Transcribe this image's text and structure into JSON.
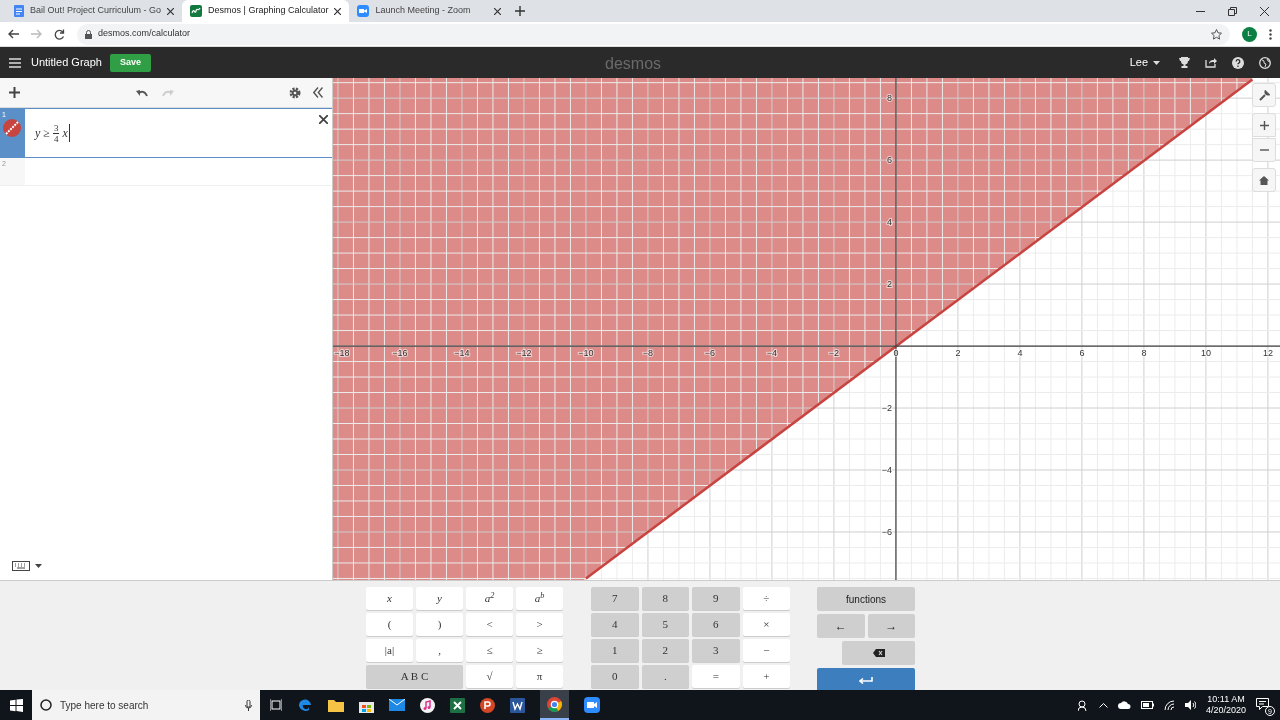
{
  "browser": {
    "tabs": [
      {
        "title": "Bail Out! Project Curriculum - Go",
        "selected": false
      },
      {
        "title": "Desmos | Graphing Calculator",
        "selected": true
      },
      {
        "title": "Launch Meeting - Zoom",
        "selected": false
      }
    ],
    "url": "desmos.com/calculator",
    "profile_initial": "L"
  },
  "header": {
    "graph_title": "Untitled Graph",
    "save_label": "Save",
    "logo": "desmos",
    "user": "Lee"
  },
  "expressions": [
    {
      "number": "1",
      "kind": "inequality",
      "selected": true,
      "color": "#c74440",
      "lhs": "y ≥",
      "numerator": "3",
      "denominator": "4",
      "rhs": "x"
    },
    {
      "number": "2",
      "kind": "empty",
      "selected": false
    }
  ],
  "graph": {
    "chart_data": {
      "type": "line",
      "x": [
        -10,
        11.5
      ],
      "series": [
        {
          "color": "#c74440",
          "values": [
            -7.5,
            8.6
          ]
        }
      ],
      "grid": true,
      "xlim": [
        -18.16,
        12.39
      ],
      "ylim": [
        -7.55,
        8.65
      ],
      "xticks": [
        -18,
        -16,
        -14,
        -12,
        -10,
        -8,
        -6,
        -4,
        -2,
        0,
        2,
        4,
        6,
        8,
        10,
        12
      ],
      "yticks": [
        -6,
        -4,
        -2,
        2,
        4,
        6,
        8
      ]
    }
  },
  "keypad": {
    "left": [
      {
        "label": "x",
        "kind": "light"
      },
      {
        "label": "y",
        "kind": "light"
      },
      {
        "label": "a$^{2}$",
        "kind": "light"
      },
      {
        "label": "a$^{b}$",
        "kind": "light"
      },
      {
        "label": "(",
        "kind": "light"
      },
      {
        "label": ")",
        "kind": "light"
      },
      {
        "label": "<",
        "kind": "light"
      },
      {
        "label": ">",
        "kind": "light"
      },
      {
        "label": "|a|",
        "kind": "light"
      },
      {
        "label": ",",
        "kind": "light"
      },
      {
        "label": "≤",
        "kind": "light"
      },
      {
        "label": "≥",
        "kind": "light"
      },
      {
        "label": "A B C",
        "kind": "wide"
      },
      {
        "label": "√",
        "kind": "light"
      },
      {
        "label": "π",
        "kind": "light"
      }
    ],
    "middle": [
      {
        "label": "7",
        "kind": "dark"
      },
      {
        "label": "8",
        "kind": "dark"
      },
      {
        "label": "9",
        "kind": "dark"
      },
      {
        "label": "÷",
        "kind": "light"
      },
      {
        "label": "4",
        "kind": "dark"
      },
      {
        "label": "5",
        "kind": "dark"
      },
      {
        "label": "6",
        "kind": "dark"
      },
      {
        "label": "×",
        "kind": "light"
      },
      {
        "label": "1",
        "kind": "dark"
      },
      {
        "label": "2",
        "kind": "dark"
      },
      {
        "label": "3",
        "kind": "dark"
      },
      {
        "label": "−",
        "kind": "light"
      },
      {
        "label": "0",
        "kind": "dark"
      },
      {
        "label": ".",
        "kind": "dark"
      },
      {
        "label": "=",
        "kind": "light"
      },
      {
        "label": "+",
        "kind": "light"
      }
    ],
    "right": [
      {
        "label": "functions",
        "kind": "text"
      },
      {
        "label": "←",
        "kind": "text"
      },
      {
        "label": "→",
        "kind": "text"
      },
      {
        "kind": "backspace"
      },
      {
        "kind": "enter"
      }
    ]
  },
  "taskbar": {
    "search_placeholder": "Type here to search",
    "time": "10:11 AM",
    "date": "4/20/2020",
    "notifications": "9"
  }
}
